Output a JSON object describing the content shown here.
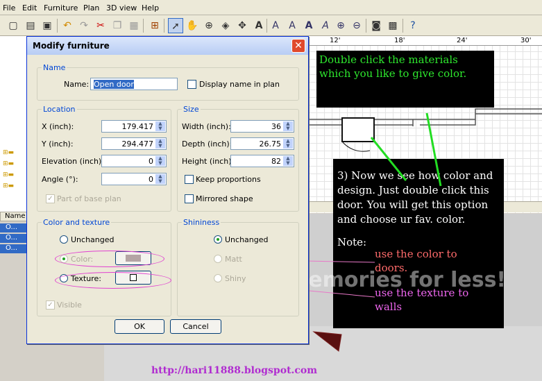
{
  "menu": [
    "File",
    "Edit",
    "Furniture",
    "Plan",
    "3D view",
    "Help"
  ],
  "ruler_labels": [
    "12'",
    "18'",
    "24'",
    "30'"
  ],
  "left_list": {
    "header": "Name",
    "rows": [
      "O...",
      "O...",
      "O..."
    ]
  },
  "dialog": {
    "title": "Modify furniture",
    "name_group": "Name",
    "name_label": "Name:",
    "name_value": "Open door",
    "display_name_label": "Display name in plan",
    "location_group": "Location",
    "x_label": "X (inch):",
    "x_value": "179.417",
    "y_label": "Y (inch):",
    "y_value": "294.477",
    "elevation_label": "Elevation (inch):",
    "elevation_value": "0",
    "angle_label": "Angle (°):",
    "angle_value": "0",
    "base_plan_label": "Part of base plan",
    "size_group": "Size",
    "width_label": "Width (inch):",
    "width_value": "36",
    "depth_label": "Depth (inch):",
    "depth_value": "26.75",
    "height_label": "Height (inch):",
    "height_value": "82",
    "keep_proportions_label": "Keep proportions",
    "mirrored_label": "Mirrored shape",
    "color_group": "Color and texture",
    "unchanged_label": "Unchanged",
    "color_label": "Color:",
    "texture_label": "Texture:",
    "visible_label": "Visible",
    "shininess_group": "Shininess",
    "shine_unchanged_label": "Unchanged",
    "matt_label": "Matt",
    "shiny_label": "Shiny",
    "ok_label": "OK",
    "cancel_label": "Cancel"
  },
  "annotations": {
    "callout_top": "Double click the materials which you like to give color.",
    "callout_main": "3) Now we see how color and design. Just double click this door. You will get this option and choose ur fav. color.",
    "note_label": "Note:",
    "note_color": "use the color to doors.",
    "note_texture": "use the texture to walls",
    "url": "http://hari11888.blogspot.com",
    "watermark_big": "Protect more of your memories for less!"
  },
  "colors": {
    "callout_bg": "#000000",
    "callout_top_text": "#2ee82e",
    "note_color_text": "#ff6b6b",
    "note_texture_text": "#ee66ee",
    "url_text": "#b02cd0",
    "arrow": "#22dd22",
    "color_swatch": "#b4a4a4"
  }
}
